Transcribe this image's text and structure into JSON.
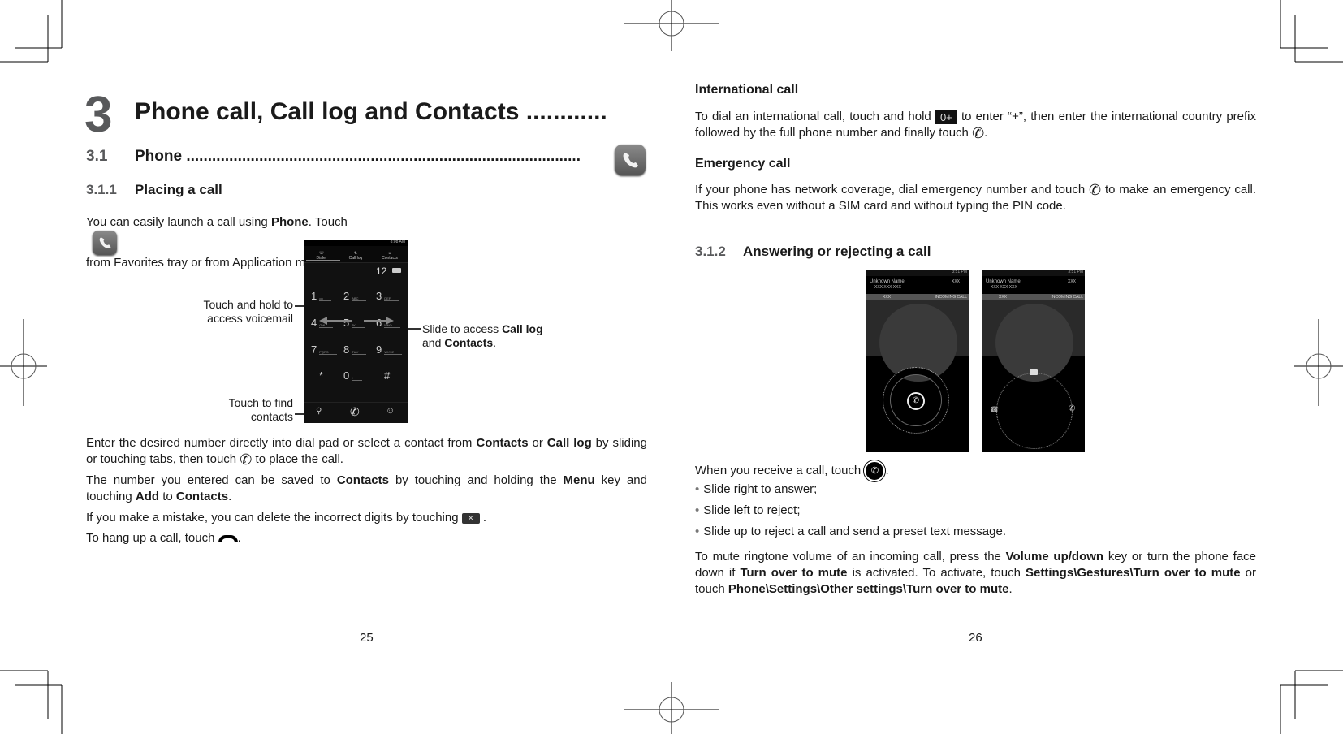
{
  "left_page": {
    "chapter": {
      "number": "3",
      "title": "Phone call, Call log and Contacts ............"
    },
    "section": {
      "number": "3.1",
      "title": "Phone ............................................................................................"
    },
    "subsection": {
      "number": "3.1.1",
      "title": "Placing a call"
    },
    "intro": {
      "part1": "You can easily launch a call using ",
      "bold1": "Phone",
      "part2": ". Touch ",
      "part3": " from Favorites tray or from Application  menu."
    },
    "figure": {
      "labels": {
        "voicemail": "Touch and hold to access voicemail",
        "find_contacts": "Touch to find contacts",
        "slide_prefix": "Slide to access ",
        "slide_bold1": "Call log",
        "slide_mid": " and ",
        "slide_bold2": "Contacts",
        "slide_suffix": "."
      },
      "dialer": {
        "status_time": "8:08 AM",
        "tabs": [
          "Dialer",
          "Call log",
          "Contacts"
        ],
        "entered_number": "12",
        "keys": [
          {
            "digit": "1",
            "letters": "oo"
          },
          {
            "digit": "2",
            "letters": "ABC"
          },
          {
            "digit": "3",
            "letters": "DEF"
          },
          {
            "digit": "4",
            "letters": "GHI"
          },
          {
            "digit": "5",
            "letters": "JKL"
          },
          {
            "digit": "6",
            "letters": "MNO"
          },
          {
            "digit": "7",
            "letters": "PQRS"
          },
          {
            "digit": "8",
            "letters": "TUV"
          },
          {
            "digit": "9",
            "letters": "WXYZ"
          },
          {
            "digit": "*",
            "letters": ""
          },
          {
            "digit": "0",
            "letters": "+"
          },
          {
            "digit": "#",
            "letters": ""
          }
        ]
      }
    },
    "paragraphs": {
      "p1_a": "Enter the desired number directly into dial pad or select a contact from ",
      "p1_b": "Contacts",
      "p1_c": " or ",
      "p1_d": "Call log",
      "p1_e": " by sliding or touching tabs, then touch ",
      "p1_f": " to place the call.",
      "p2_a": "The number you entered can be saved to ",
      "p2_b": "Contacts",
      "p2_c": " by touching and holding the ",
      "p2_d": "Menu",
      "p2_e": " key and touching ",
      "p2_f": "Add",
      "p2_g": " to ",
      "p2_h": "Contacts",
      "p2_i": ".",
      "p3_a": "If you make a mistake, you can delete the incorrect digits by touching ",
      "p3_b": " .",
      "p4_a": "To hang up a call, touch ",
      "p4_b": "."
    },
    "page_number": "25"
  },
  "right_page": {
    "international": {
      "heading": "International call",
      "a": "To dial an international call, touch and hold ",
      "key_label": "0+",
      "b": " to enter “+”, then enter the international country prefix followed by the full phone number and finally touch ",
      "c": "."
    },
    "emergency": {
      "heading": "Emergency call",
      "a": "If your phone has network coverage, dial emergency number and touch ",
      "b": " to make an emergency call. This works even without a SIM card and without typing the PIN code."
    },
    "subsection": {
      "number": "3.1.2",
      "title": "Answering or rejecting a call"
    },
    "incoming_screens": [
      {
        "status_time": "3:51 PM",
        "caller_name": "Unknown Name",
        "caller_number": "XXX XXX XXX",
        "carrier": "XXX",
        "location": "XXX",
        "state": "INCOMING CALL"
      },
      {
        "status_time": "3:51 PM",
        "caller_name": "Unknown Name",
        "caller_number": "XXX XXX XXX",
        "carrier": "XXX",
        "location": "XXX",
        "state": "INCOMING CALL"
      }
    ],
    "receive": {
      "intro_a": "When you receive a call, touch ",
      "intro_b": ".",
      "bullets": [
        "Slide right to answer;",
        "Slide left to reject;",
        "Slide up to reject a call and send a preset text message."
      ]
    },
    "mute": {
      "a": "To mute ringtone volume of an incoming call, press the ",
      "b": "Volume up/down",
      "c": " key or turn the phone face down if ",
      "d": "Turn over to mute",
      "e": " is activated. To activate, touch ",
      "f": "Settings\\Gestures\\Turn over to mute",
      "g": " or touch ",
      "h": "Phone\\Settings\\Other settings\\Turn over to mute",
      "i": "."
    },
    "page_number": "26"
  },
  "icons": {
    "phone_app": "phone-app-icon",
    "call": "call-handset-icon",
    "delete": "backspace-icon",
    "hangup": "hang-up-icon",
    "answer": "answer-circle-icon"
  },
  "colors": {
    "heading_number": "#58595b",
    "text": "#1a1a1a",
    "phone_screen": "#111111"
  }
}
